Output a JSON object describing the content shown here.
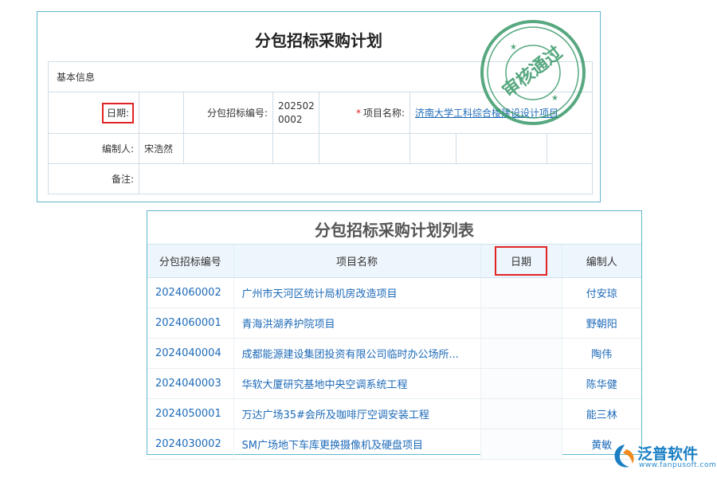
{
  "form": {
    "title": "分包招标采购计划",
    "section": "基本信息",
    "date_label": "日期:",
    "code_label": "分包招标编号:",
    "code_value_line1": "202502",
    "code_value_line2": "0002",
    "project_label": "项目名称:",
    "project_value": "济南大学工科综合楼建设设计项目",
    "creator_label": "编制人:",
    "creator_value": "宋浩然",
    "remark_label": "备注:"
  },
  "stamp": {
    "text": "审核通过",
    "color": "#3a9a6a"
  },
  "list": {
    "title": "分包招标采购计划列表",
    "columns": [
      "分包招标编号",
      "项目名称",
      "日期",
      "编制人"
    ],
    "rows": [
      {
        "code": "2024060002",
        "name": "广州市天河区统计局机房改造项目",
        "creator": "付安琼"
      },
      {
        "code": "2024060001",
        "name": "青海洪湖养护院项目",
        "creator": "野朝阳"
      },
      {
        "code": "2024040004",
        "name": "成都能源建设集团投资有限公司临时办公场所...",
        "creator": "陶伟"
      },
      {
        "code": "2024040003",
        "name": "华软大厦研究基地中央空调系统工程",
        "creator": "陈华健"
      },
      {
        "code": "2024050001",
        "name": "万达广场35#会所及咖啡厅空调安装工程",
        "creator": "能三林"
      },
      {
        "code": "2024030002",
        "name": "SM广场地下车库更换摄像机及硬盘项目",
        "creator": "黄敏"
      }
    ]
  },
  "logo": {
    "name": "泛普软件",
    "url": "www.fanpusoft.com",
    "color": "#1b7fc4"
  },
  "colors": {
    "link": "#1d6ab8",
    "highlight": "#e02424",
    "border": "#5fb8cf"
  }
}
